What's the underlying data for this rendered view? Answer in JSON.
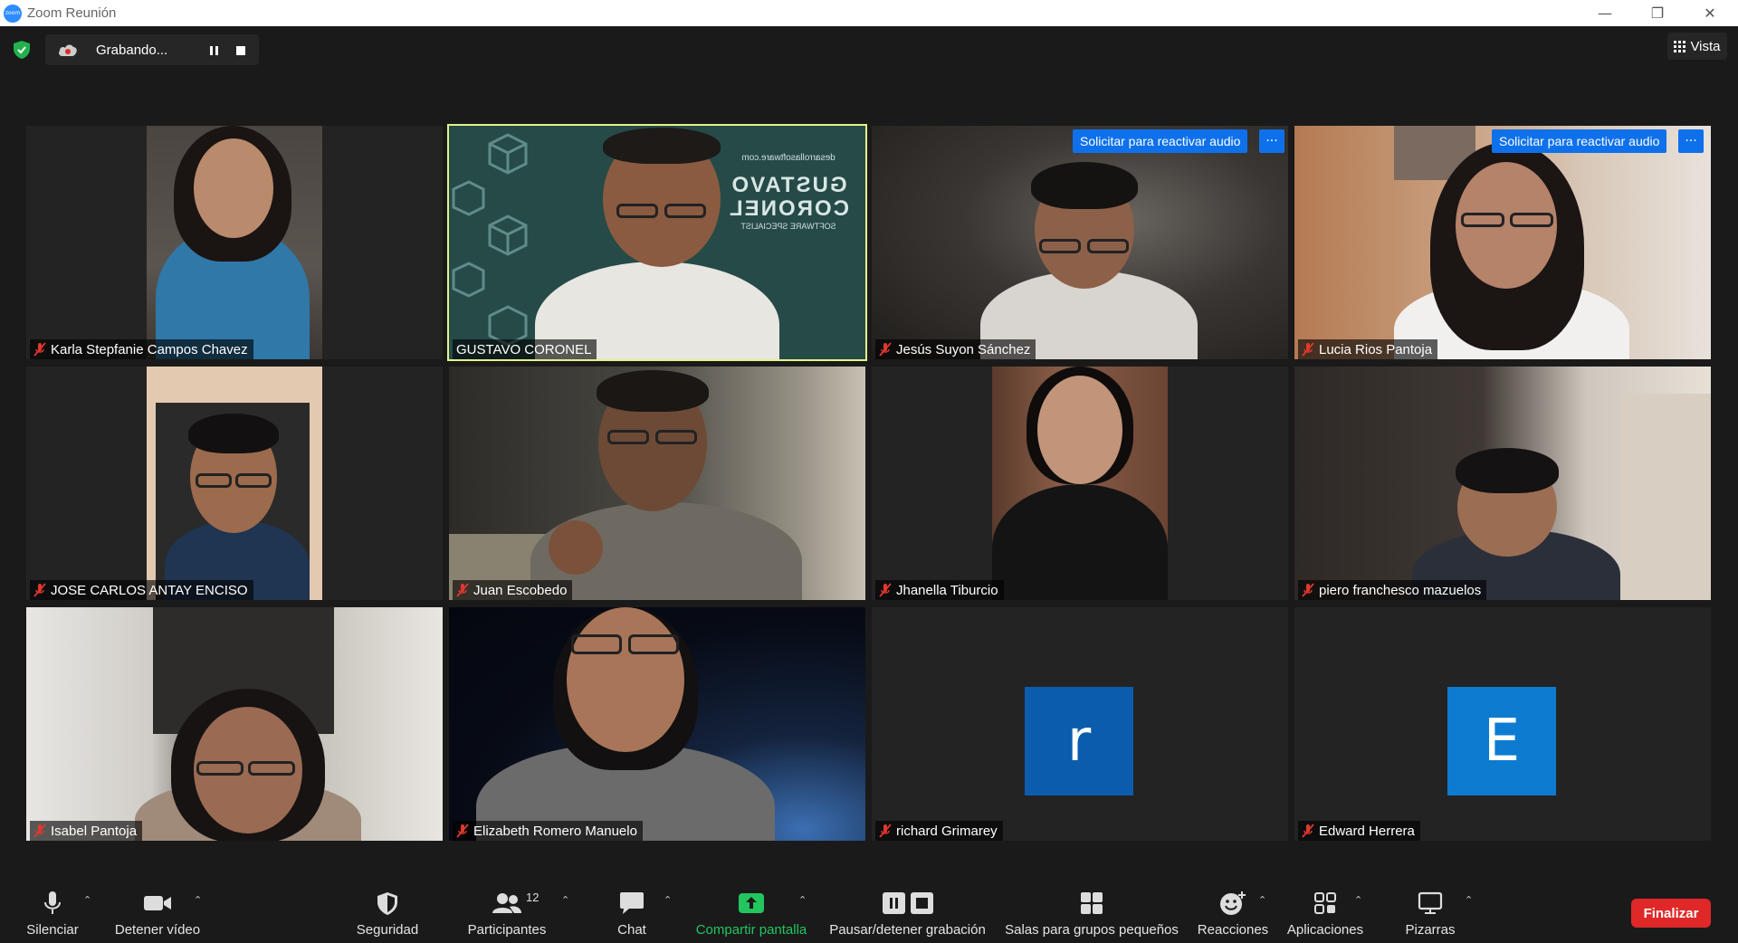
{
  "window": {
    "title": "Zoom Reunión",
    "logo_text": "zoom"
  },
  "topbar": {
    "recording_label": "Grabando...",
    "view_label": "Vista"
  },
  "participants_grid": [
    {
      "name": "Karla Stepfanie Campos Chavez",
      "muted": true
    },
    {
      "name": "GUSTAVO CORONEL",
      "muted": false,
      "active_speaker": true,
      "background_text": {
        "site": "desarrollasoftware.com",
        "line1": "GUSTAVO",
        "line2": "CORONEL",
        "line3": "SOFTWARE SPECIALIST"
      }
    },
    {
      "name": "Jesús Suyon Sánchez",
      "muted": true,
      "request_label": "Solicitar para reactivar audio",
      "more_label": "···"
    },
    {
      "name": "Lucia Rios Pantoja",
      "muted": true,
      "request_label": "Solicitar para reactivar audio",
      "more_label": "···"
    },
    {
      "name": "JOSE CARLOS ANTAY ENCISO",
      "muted": true
    },
    {
      "name": "Juan Escobedo",
      "muted": true
    },
    {
      "name": "Jhanella Tiburcio",
      "muted": true
    },
    {
      "name": "piero franchesco mazuelos",
      "muted": true
    },
    {
      "name": "Isabel Pantoja",
      "muted": true
    },
    {
      "name": "Elizabeth Romero Manuelo",
      "muted": true
    },
    {
      "name": "richard Grimarey",
      "muted": true,
      "avatar_letter": "r",
      "avatar_color": "#0b5cad"
    },
    {
      "name": "Edward Herrera",
      "muted": true,
      "avatar_letter": "E",
      "avatar_color": "#0d7bd0"
    }
  ],
  "toolbar": {
    "mute_label": "Silenciar",
    "video_label": "Detener vídeo",
    "security_label": "Seguridad",
    "participants_label": "Participantes",
    "participants_count": "12",
    "chat_label": "Chat",
    "share_label": "Compartir pantalla",
    "recording_label": "Pausar/detener grabación",
    "breakout_label": "Salas para grupos pequeños",
    "reactions_label": "Reacciones",
    "apps_label": "Aplicaciones",
    "whiteboards_label": "Pizarras",
    "end_label": "Finalizar"
  },
  "colors": {
    "accent_blue": "#0e71eb",
    "share_green": "#22c55e",
    "end_red": "#e02828",
    "speaker_outline": "#e6f28a",
    "muted_red": "#e0382d"
  }
}
